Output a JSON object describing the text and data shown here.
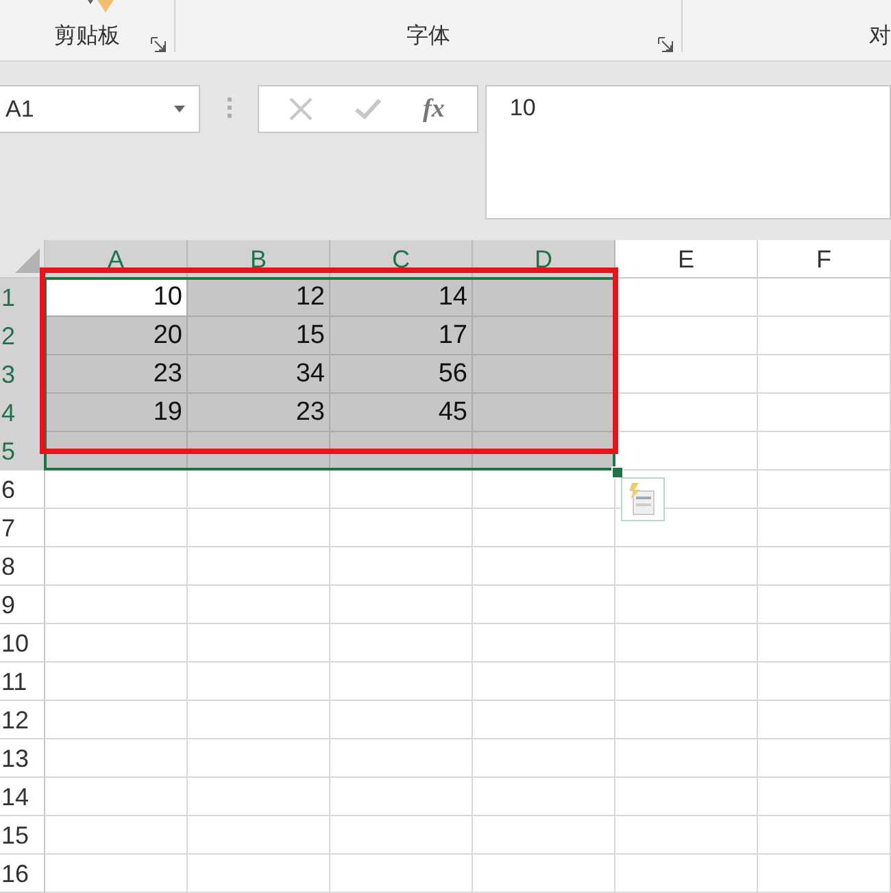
{
  "ribbon": {
    "groups": [
      {
        "label": "剪贴板",
        "has_launcher": true
      },
      {
        "label": "字体",
        "has_launcher": true
      },
      {
        "label": "对",
        "has_launcher": false
      }
    ]
  },
  "formula_bar": {
    "name_box": "A1",
    "function_label": "fx",
    "value": "10"
  },
  "sheet": {
    "columns": [
      {
        "label": "A",
        "selected": true
      },
      {
        "label": "B",
        "selected": true
      },
      {
        "label": "C",
        "selected": true
      },
      {
        "label": "D",
        "selected": true
      },
      {
        "label": "E",
        "selected": false
      },
      {
        "label": "F",
        "selected": false
      }
    ],
    "rows": [
      {
        "label": "1",
        "selected": true,
        "cells": [
          {
            "value": "10",
            "selected": true
          },
          {
            "value": "12",
            "selected": true
          },
          {
            "value": "14",
            "selected": true
          },
          {
            "selected": true
          },
          {
            "selected": false
          },
          {
            "selected": false
          }
        ]
      },
      {
        "label": "2",
        "selected": true,
        "cells": [
          {
            "value": "20",
            "selected": true
          },
          {
            "value": "15",
            "selected": true
          },
          {
            "value": "17",
            "selected": true
          },
          {
            "selected": true
          },
          {
            "selected": false
          },
          {
            "selected": false
          }
        ]
      },
      {
        "label": "3",
        "selected": true,
        "cells": [
          {
            "value": "23",
            "selected": true
          },
          {
            "value": "34",
            "selected": true
          },
          {
            "value": "56",
            "selected": true
          },
          {
            "selected": true
          },
          {
            "selected": false
          },
          {
            "selected": false
          }
        ]
      },
      {
        "label": "4",
        "selected": true,
        "cells": [
          {
            "value": "19",
            "selected": true
          },
          {
            "value": "23",
            "selected": true
          },
          {
            "value": "45",
            "selected": true
          },
          {
            "selected": true
          },
          {
            "selected": false
          },
          {
            "selected": false
          }
        ]
      },
      {
        "label": "5",
        "selected": true,
        "cells": [
          {
            "selected": true
          },
          {
            "selected": true
          },
          {
            "selected": true
          },
          {
            "selected": true
          },
          {
            "selected": false
          },
          {
            "selected": false
          }
        ]
      },
      {
        "label": "6",
        "selected": false,
        "cells": [
          {
            "selected": false
          },
          {
            "selected": false
          },
          {
            "selected": false
          },
          {
            "selected": false
          },
          {
            "selected": false
          },
          {
            "selected": false
          }
        ]
      },
      {
        "label": "7",
        "selected": false,
        "cells": [
          {
            "selected": false
          },
          {
            "selected": false
          },
          {
            "selected": false
          },
          {
            "selected": false
          },
          {
            "selected": false
          },
          {
            "selected": false
          }
        ]
      },
      {
        "label": "8",
        "selected": false,
        "cells": [
          {
            "selected": false
          },
          {
            "selected": false
          },
          {
            "selected": false
          },
          {
            "selected": false
          },
          {
            "selected": false
          },
          {
            "selected": false
          }
        ]
      },
      {
        "label": "9",
        "selected": false,
        "cells": [
          {
            "selected": false
          },
          {
            "selected": false
          },
          {
            "selected": false
          },
          {
            "selected": false
          },
          {
            "selected": false
          },
          {
            "selected": false
          }
        ]
      },
      {
        "label": "10",
        "selected": false,
        "cells": [
          {
            "selected": false
          },
          {
            "selected": false
          },
          {
            "selected": false
          },
          {
            "selected": false
          },
          {
            "selected": false
          },
          {
            "selected": false
          }
        ]
      },
      {
        "label": "11",
        "selected": false,
        "cells": [
          {
            "selected": false
          },
          {
            "selected": false
          },
          {
            "selected": false
          },
          {
            "selected": false
          },
          {
            "selected": false
          },
          {
            "selected": false
          }
        ]
      },
      {
        "label": "12",
        "selected": false,
        "cells": [
          {
            "selected": false
          },
          {
            "selected": false
          },
          {
            "selected": false
          },
          {
            "selected": false
          },
          {
            "selected": false
          },
          {
            "selected": false
          }
        ]
      },
      {
        "label": "13",
        "selected": false,
        "cells": [
          {
            "selected": false
          },
          {
            "selected": false
          },
          {
            "selected": false
          },
          {
            "selected": false
          },
          {
            "selected": false
          },
          {
            "selected": false
          }
        ]
      },
      {
        "label": "14",
        "selected": false,
        "cells": [
          {
            "selected": false
          },
          {
            "selected": false
          },
          {
            "selected": false
          },
          {
            "selected": false
          },
          {
            "selected": false
          },
          {
            "selected": false
          }
        ]
      },
      {
        "label": "15",
        "selected": false,
        "cells": [
          {
            "selected": false
          },
          {
            "selected": false
          },
          {
            "selected": false
          },
          {
            "selected": false
          },
          {
            "selected": false
          },
          {
            "selected": false
          }
        ]
      },
      {
        "label": "16",
        "selected": false,
        "cells": [
          {
            "selected": false
          },
          {
            "selected": false
          },
          {
            "selected": false
          },
          {
            "selected": false
          },
          {
            "selected": false
          },
          {
            "selected": false
          }
        ]
      }
    ]
  }
}
